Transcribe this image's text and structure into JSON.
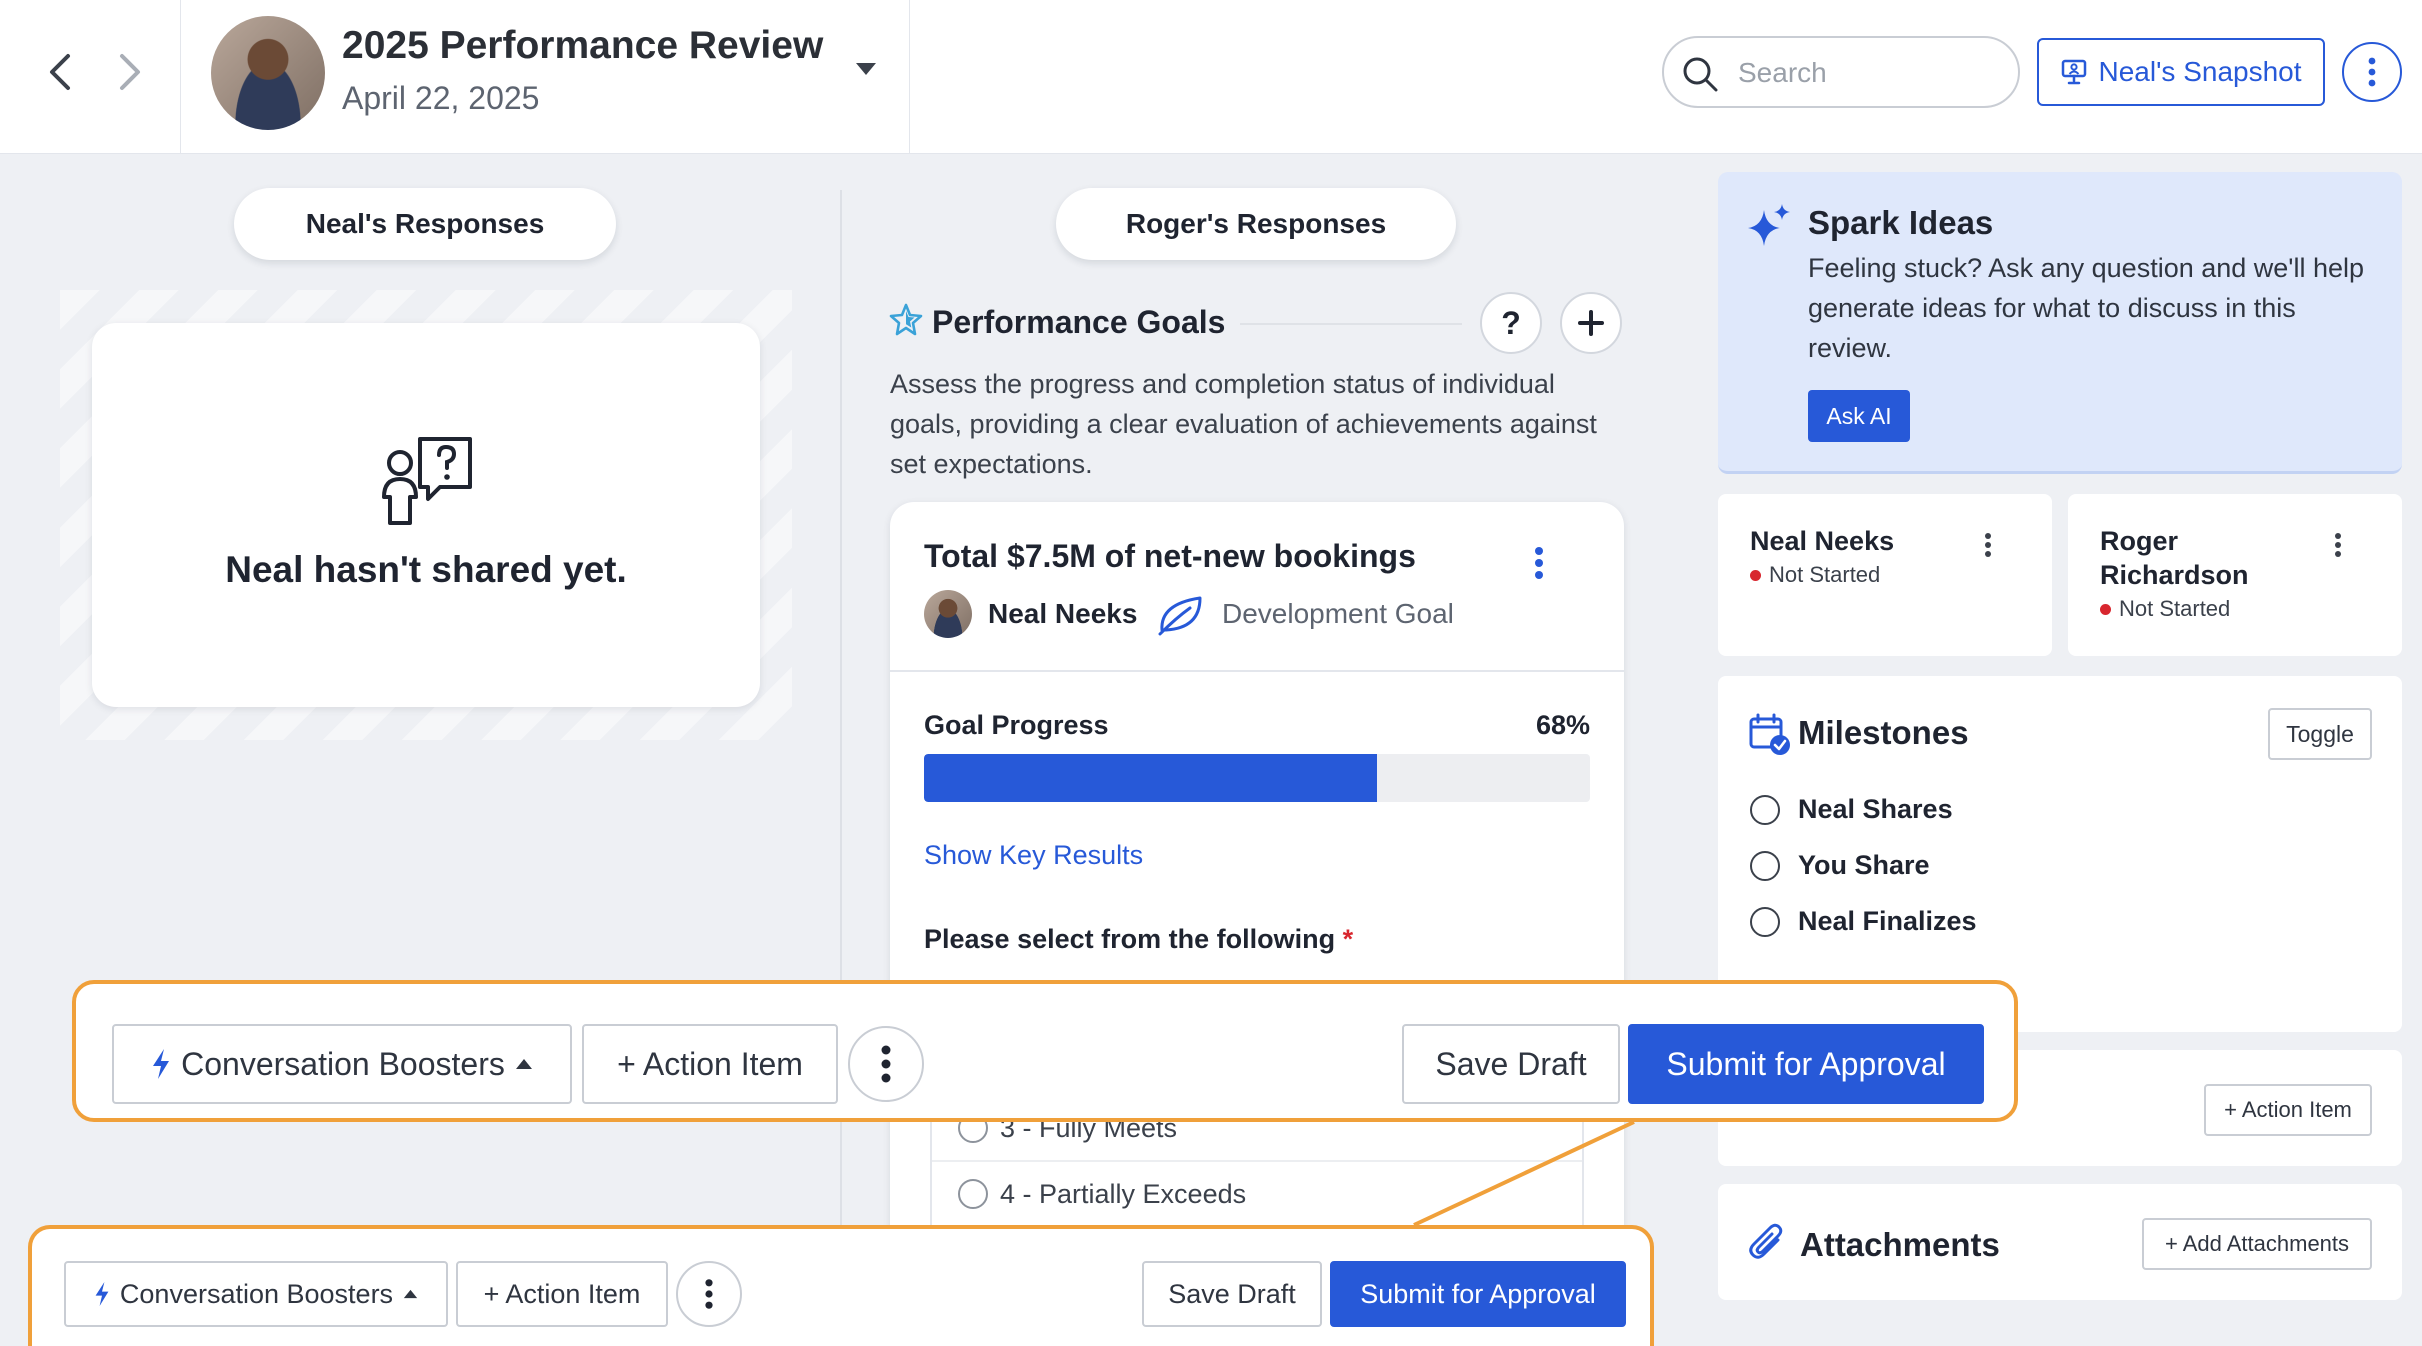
{
  "colors": {
    "accent": "#2759d8",
    "highlight": "#f0a03a",
    "status_dot": "#d8262e",
    "spark_bg": "#dfe8fb"
  },
  "header": {
    "title": "2025 Performance Review",
    "date": "April 22, 2025",
    "search_placeholder": "Search",
    "snapshot_label": "Neal's Snapshot"
  },
  "tabs": {
    "left": "Neal's Responses",
    "right": "Roger's Responses"
  },
  "left_panel": {
    "empty_message": "Neal hasn't shared yet."
  },
  "performance_goals": {
    "title": "Performance Goals",
    "help_label": "?",
    "add_label": "+",
    "description": "Assess the progress and completion status of individual goals, providing a clear evaluation of achievements against set expectations.",
    "goal": {
      "title": "Total $7.5M of net-new bookings",
      "owner": "Neal Neeks",
      "type": "Development Goal",
      "progress_label": "Goal Progress",
      "progress_text": "68%",
      "progress_value": 68,
      "show_key_results": "Show Key Results",
      "select_label": "Please select from the following",
      "required_mark": "*",
      "options": [
        "3 - Fully Meets",
        "4 - Partially Exceeds"
      ]
    }
  },
  "spark": {
    "title": "Spark Ideas",
    "description": "Feeling stuck? Ask any question and we'll help generate ideas for what to discuss in this review.",
    "button": "Ask AI"
  },
  "participants": [
    {
      "name": "Neal Neeks",
      "status": "Not Started"
    },
    {
      "name": "Roger Richardson",
      "status": "Not Started"
    }
  ],
  "milestones": {
    "title": "Milestones",
    "toggle_label": "Toggle",
    "items": [
      "Neal Shares",
      "You Share",
      "Neal Finalizes"
    ]
  },
  "action_items_panel": {
    "button": "+ Action Item"
  },
  "attachments": {
    "title": "Attachments",
    "button": "+ Add Attachments"
  },
  "action_bar": {
    "boosters": "Conversation Boosters",
    "action_item": "+ Action Item",
    "save_draft": "Save Draft",
    "submit": "Submit for Approval"
  }
}
